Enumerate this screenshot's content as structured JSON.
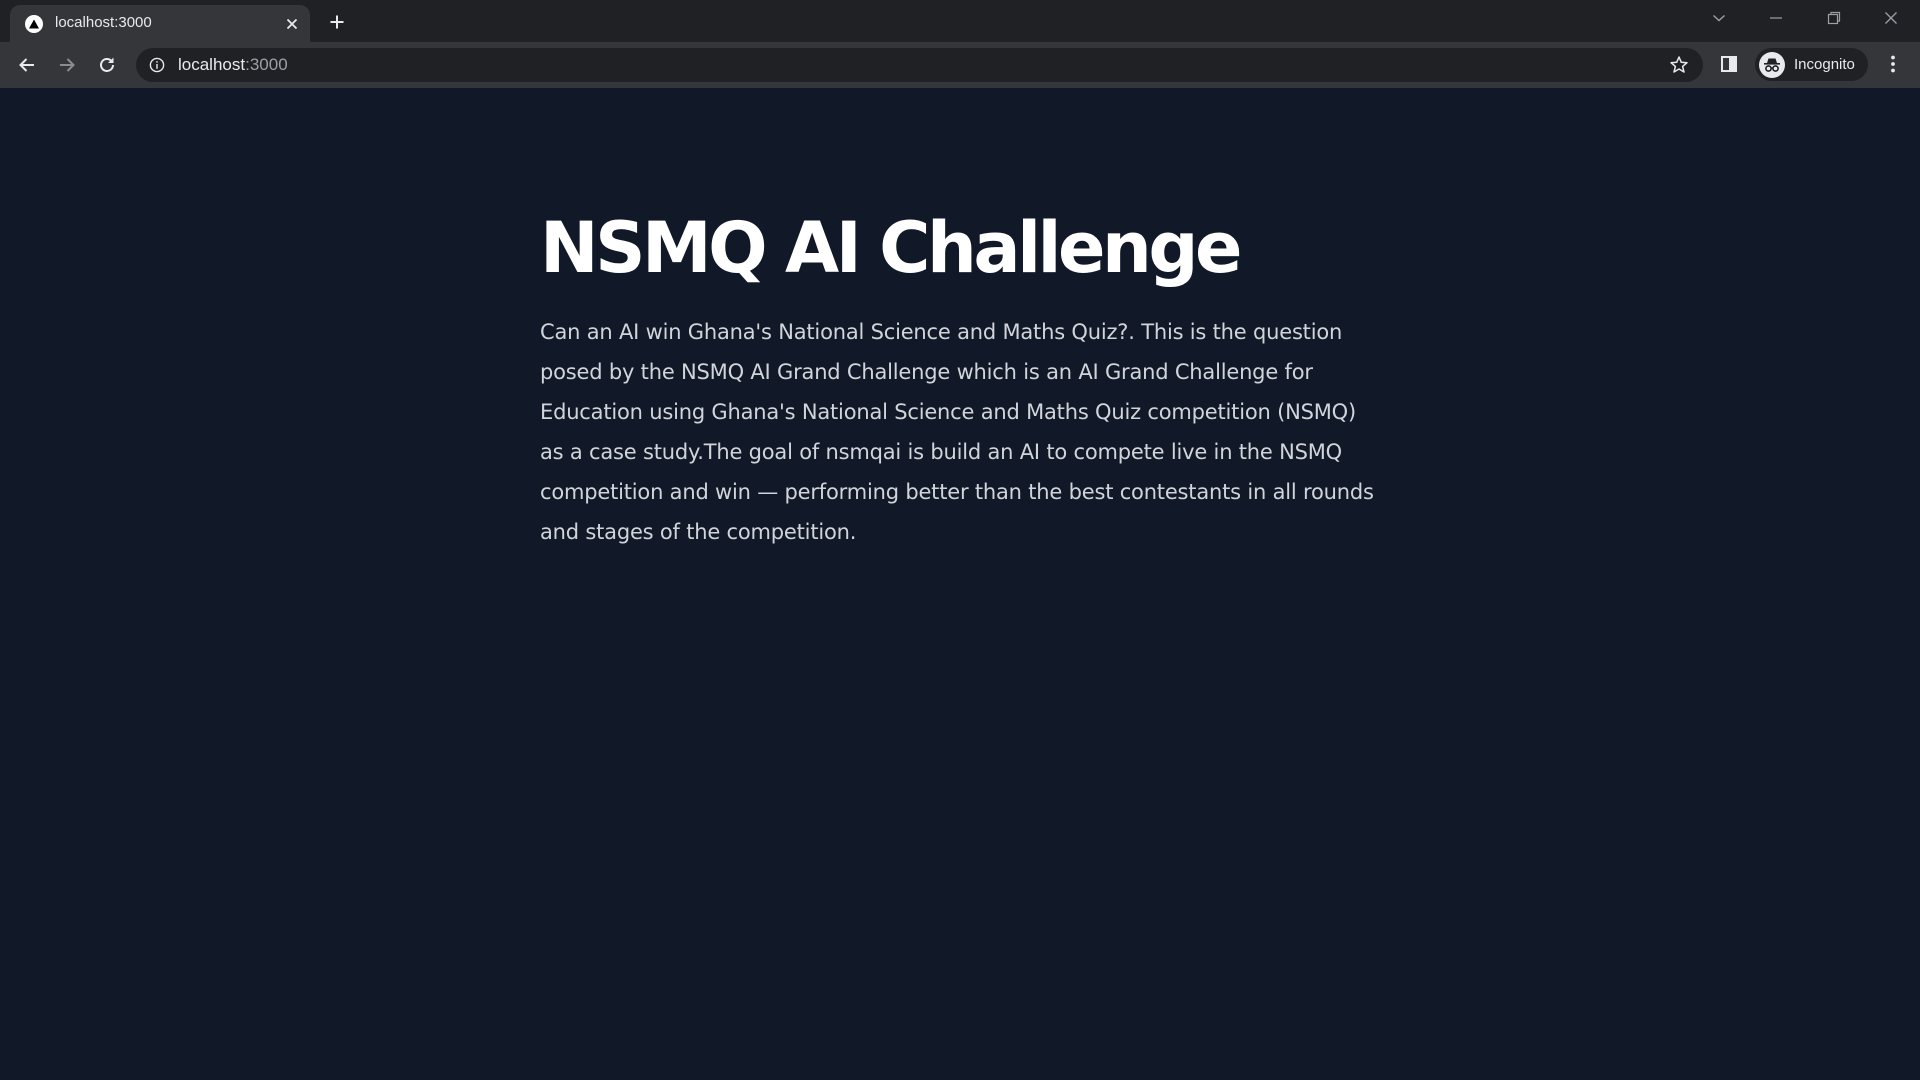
{
  "browser": {
    "tab": {
      "title": "localhost:3000"
    },
    "address_bar": {
      "host": "localhost",
      "port": ":3000"
    },
    "profile": {
      "label": "Incognito"
    }
  },
  "main": {
    "title": "NSMQ AI Challenge",
    "description": "Can an AI win Ghana's National Science and Maths Quiz?. This is the question posed by the NSMQ AI Grand Challenge which is an AI Grand Challenge for Education using Ghana's National Science and Maths Quiz competition (NSMQ) as a case study.The goal of nsmqai is build an AI to compete live in the NSMQ competition and win — performing better than the best contestants in all rounds and stages of the competition."
  },
  "colors": {
    "page_background": "#111827",
    "title_text": "#ffffff",
    "body_text": "#d1d5db",
    "chrome_dark": "#202124",
    "chrome_toolbar": "#35363a"
  }
}
